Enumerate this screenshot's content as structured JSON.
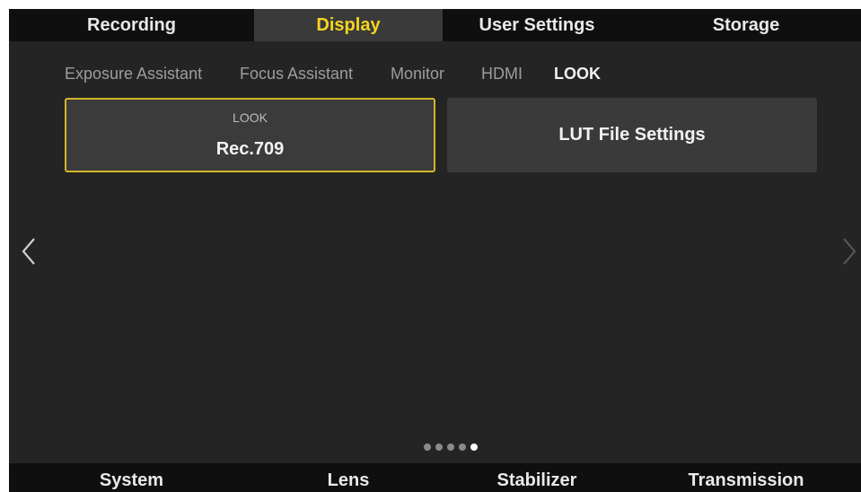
{
  "colors": {
    "accent": "#f5d421",
    "focus_border": "#d4b52a",
    "background": "#242424",
    "bar": "#0f0f0f"
  },
  "top_tabs": [
    {
      "label": "Recording",
      "active": false
    },
    {
      "label": "Display",
      "active": true
    },
    {
      "label": "User Settings",
      "active": false
    },
    {
      "label": "Storage",
      "active": false
    }
  ],
  "sub_tabs": [
    {
      "label": "Exposure Assistant",
      "active": false
    },
    {
      "label": "Focus Assistant",
      "active": false
    },
    {
      "label": "Monitor",
      "active": false
    },
    {
      "label": "HDMI",
      "active": false
    },
    {
      "label": "LOOK",
      "active": true
    }
  ],
  "look_card": {
    "label": "LOOK",
    "value": "Rec.709"
  },
  "lut_card": {
    "label": "LUT File Settings"
  },
  "navigation": {
    "prev_icon": "chevron-left-icon",
    "next_icon": "chevron-right-icon"
  },
  "pagination": {
    "total": 5,
    "current": 5
  },
  "bottom_tabs": [
    {
      "label": "System"
    },
    {
      "label": "Lens"
    },
    {
      "label": "Stabilizer"
    },
    {
      "label": "Transmission"
    }
  ]
}
